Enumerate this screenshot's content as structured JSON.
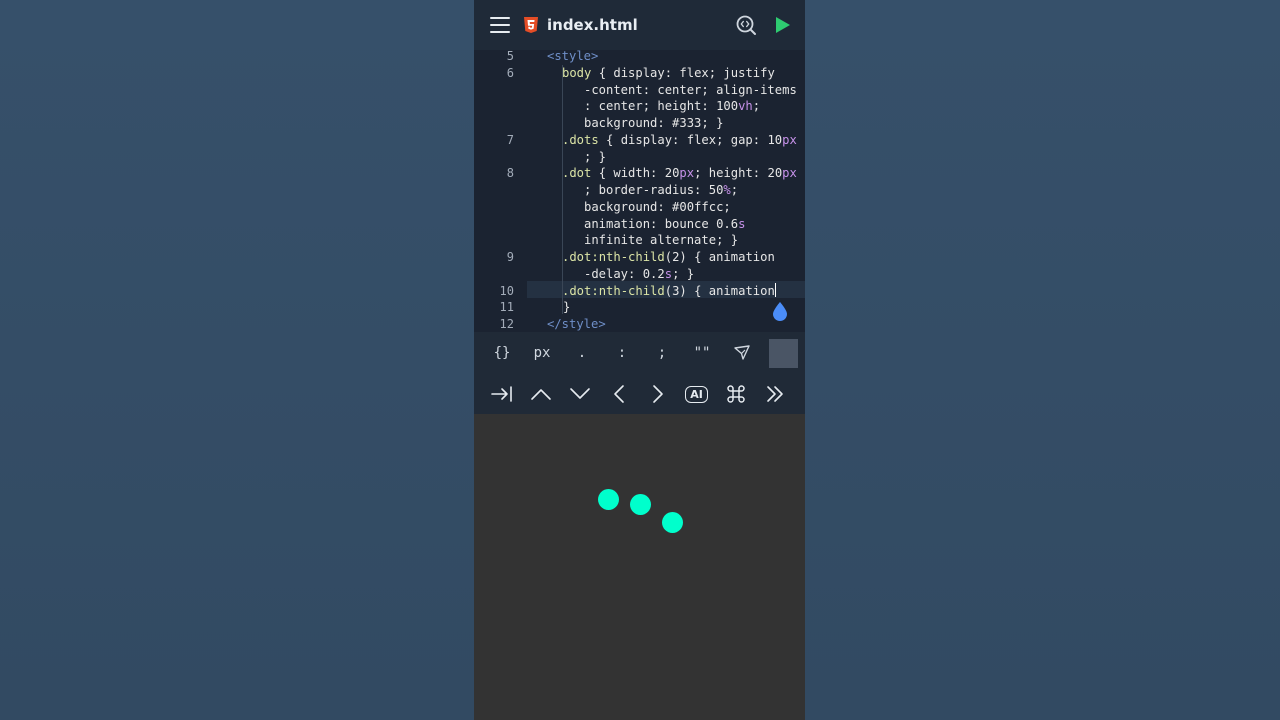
{
  "header": {
    "file_name": "index.html",
    "accent": "#2ecc71"
  },
  "editor": {
    "lines": [
      {
        "num": "5",
        "parts": [
          [
            "t-tag",
            "<style>"
          ]
        ]
      },
      {
        "num": "6",
        "parts": [
          [
            "t-sel",
            "body"
          ],
          [
            "t-prop",
            " { display: flex; justify"
          ]
        ]
      },
      {
        "num": "",
        "parts": [
          [
            "t-prop",
            "-content: center; align-items"
          ]
        ]
      },
      {
        "num": "",
        "parts": [
          [
            "t-prop",
            ": center; height: 100"
          ],
          [
            "t-unit",
            "vh"
          ],
          [
            "t-prop",
            ";"
          ]
        ]
      },
      {
        "num": "",
        "parts": [
          [
            "t-prop",
            "background: #333; }"
          ]
        ]
      },
      {
        "num": "7",
        "parts": [
          [
            "t-sel",
            ".dots"
          ],
          [
            "t-prop",
            " { display: flex; gap: 10"
          ],
          [
            "t-unit",
            "px"
          ]
        ]
      },
      {
        "num": "",
        "parts": [
          [
            "t-prop",
            "; }"
          ]
        ]
      },
      {
        "num": "8",
        "parts": [
          [
            "t-sel",
            ".dot"
          ],
          [
            "t-prop",
            " { width: 20"
          ],
          [
            "t-unit",
            "px"
          ],
          [
            "t-prop",
            "; height: 20"
          ],
          [
            "t-unit",
            "px"
          ]
        ]
      },
      {
        "num": "",
        "parts": [
          [
            "t-prop",
            "; border-radius: 50"
          ],
          [
            "t-unit",
            "%"
          ],
          [
            "t-prop",
            ";"
          ]
        ]
      },
      {
        "num": "",
        "parts": [
          [
            "t-prop",
            "background: #00ffcc;"
          ]
        ]
      },
      {
        "num": "",
        "parts": [
          [
            "t-prop",
            "animation: bounce 0.6"
          ],
          [
            "t-unit",
            "s"
          ]
        ]
      },
      {
        "num": "",
        "parts": [
          [
            "t-prop",
            "infinite alternate; }"
          ]
        ]
      },
      {
        "num": "9",
        "parts": [
          [
            "t-sel",
            ".dot"
          ],
          [
            "t-pseudo",
            ":nth-child"
          ],
          [
            "t-prop",
            "(2) { animation"
          ]
        ]
      },
      {
        "num": "",
        "parts": [
          [
            "t-prop",
            "-delay: 0.2"
          ],
          [
            "t-unit",
            "s"
          ],
          [
            "t-prop",
            "; }"
          ]
        ]
      },
      {
        "num": "10",
        "parts": [
          [
            "t-sel",
            ".dot"
          ],
          [
            "t-pseudo",
            ":nth-child"
          ],
          [
            "t-prop",
            "(3) { animation"
          ]
        ]
      },
      {
        "num": "11",
        "parts": [
          [
            "t-prop",
            "}"
          ]
        ]
      },
      {
        "num": "12",
        "parts": [
          [
            "t-tag",
            "</style>"
          ]
        ]
      }
    ]
  },
  "symbols": [
    "{}",
    "px",
    ".",
    ":",
    ";",
    "\"\""
  ],
  "nav_keys": {
    "ai_label": "AI"
  },
  "preview": {
    "dot_color": "#00ffcc",
    "background": "#333333"
  }
}
